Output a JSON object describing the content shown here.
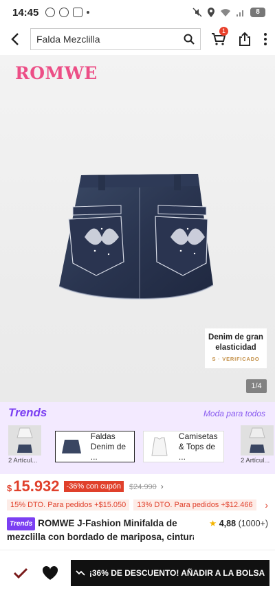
{
  "status": {
    "time": "14:45",
    "uber_label": "Uber Eats",
    "battery": "8"
  },
  "header": {
    "back_icon": "chevron-left-icon",
    "search_value": "Falda Mezclilla",
    "cart_count": "1"
  },
  "gallery": {
    "brand": "ROMWE",
    "feature_title_line1": "Denim de gran",
    "feature_title_line2": "elasticidad",
    "feature_verified": "S · VERIFICADO",
    "counter": "1/4"
  },
  "trends": {
    "logo": "Trends",
    "tagline": "Moda para todos",
    "items": [
      {
        "caption": "2 Artícul..."
      },
      {
        "label_line1": "Faldas",
        "label_line2": "Denim de ..."
      },
      {
        "label_line1": "Camisetas",
        "label_line2": "& Tops de ..."
      },
      {
        "caption": "2 Artícul..."
      }
    ]
  },
  "price": {
    "currency": "$",
    "value": "15.932",
    "discount": "-36% con cupón",
    "original": "$24.990",
    "promo1": "15% DTO. Para pedidos +$15.050",
    "promo2": "13% DTO. Para pedidos +$12.466"
  },
  "product": {
    "badge": "Trends",
    "title_line1": "ROMWE J-Fashion Minifalda de",
    "title_line2": "mezclilla con bordado de mariposa, cintura",
    "rating": "4,88",
    "rating_count": "(1000+)"
  },
  "bottom": {
    "add_label": "¡36% DE DESCUENTO! AÑADIR A LA BOLSA"
  },
  "colors": {
    "accent": "#e0402b",
    "brand_pink": "#ec4e86",
    "trends_purple": "#7b3ff2"
  }
}
